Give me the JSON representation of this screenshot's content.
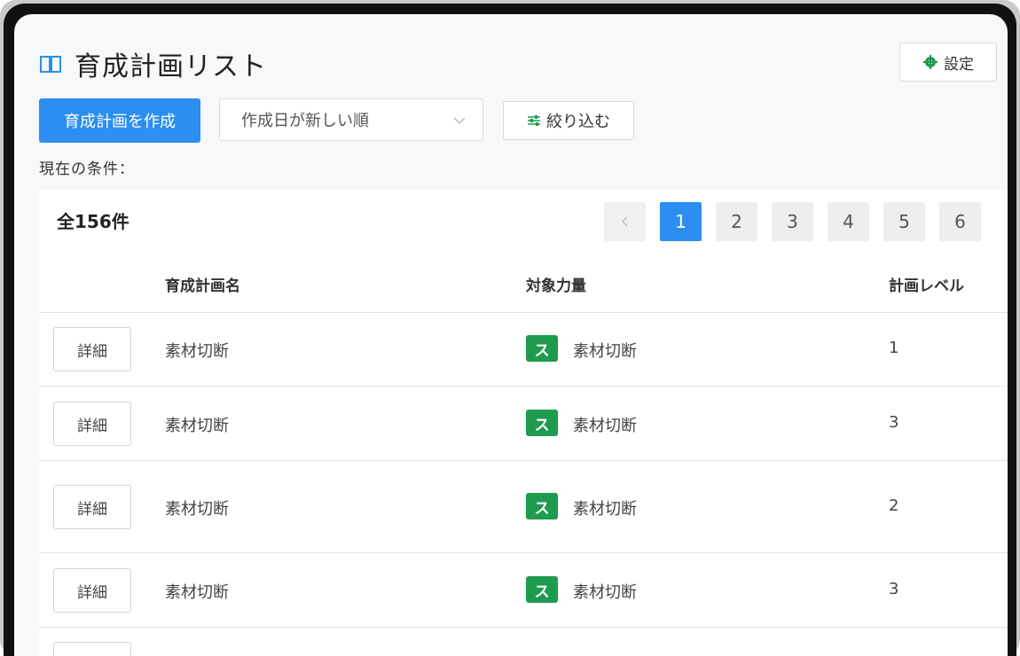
{
  "header": {
    "title": "育成計画リスト",
    "settings_label": "設定"
  },
  "toolbar": {
    "create_label": "育成計画を作成",
    "sort_value": "作成日が新しい順",
    "filter_label": "絞り込む"
  },
  "conditions_label": "現在の条件：",
  "list": {
    "total": "全156件",
    "pages": [
      "1",
      "2",
      "3",
      "4",
      "5",
      "6"
    ],
    "current_page": "1",
    "columns": {
      "plan_name": "育成計画名",
      "target_skill": "対象力量",
      "plan_level": "計画レベル"
    },
    "detail_label": "詳細",
    "rows": [
      {
        "plan_name": "素材切断",
        "skill_badge": "ス",
        "skill_name": "素材切断",
        "level": "1"
      },
      {
        "plan_name": "素材切断",
        "skill_badge": "ス",
        "skill_name": "素材切断",
        "level": "3"
      },
      {
        "plan_name": "素材切断",
        "skill_badge": "ス",
        "skill_name": "素材切断",
        "level": "2"
      },
      {
        "plan_name": "素材切断",
        "skill_badge": "ス",
        "skill_name": "素材切断",
        "level": "3"
      }
    ]
  },
  "icons": {
    "title": "book-open-icon",
    "settings": "gear-icon",
    "sort": "chevron-down-icon",
    "filter": "sliders-icon",
    "prev": "chevron-left-icon"
  },
  "colors": {
    "primary": "#2b8ef0",
    "skill_badge": "#1e9b4f",
    "title_icon": "#2b8ef0"
  }
}
